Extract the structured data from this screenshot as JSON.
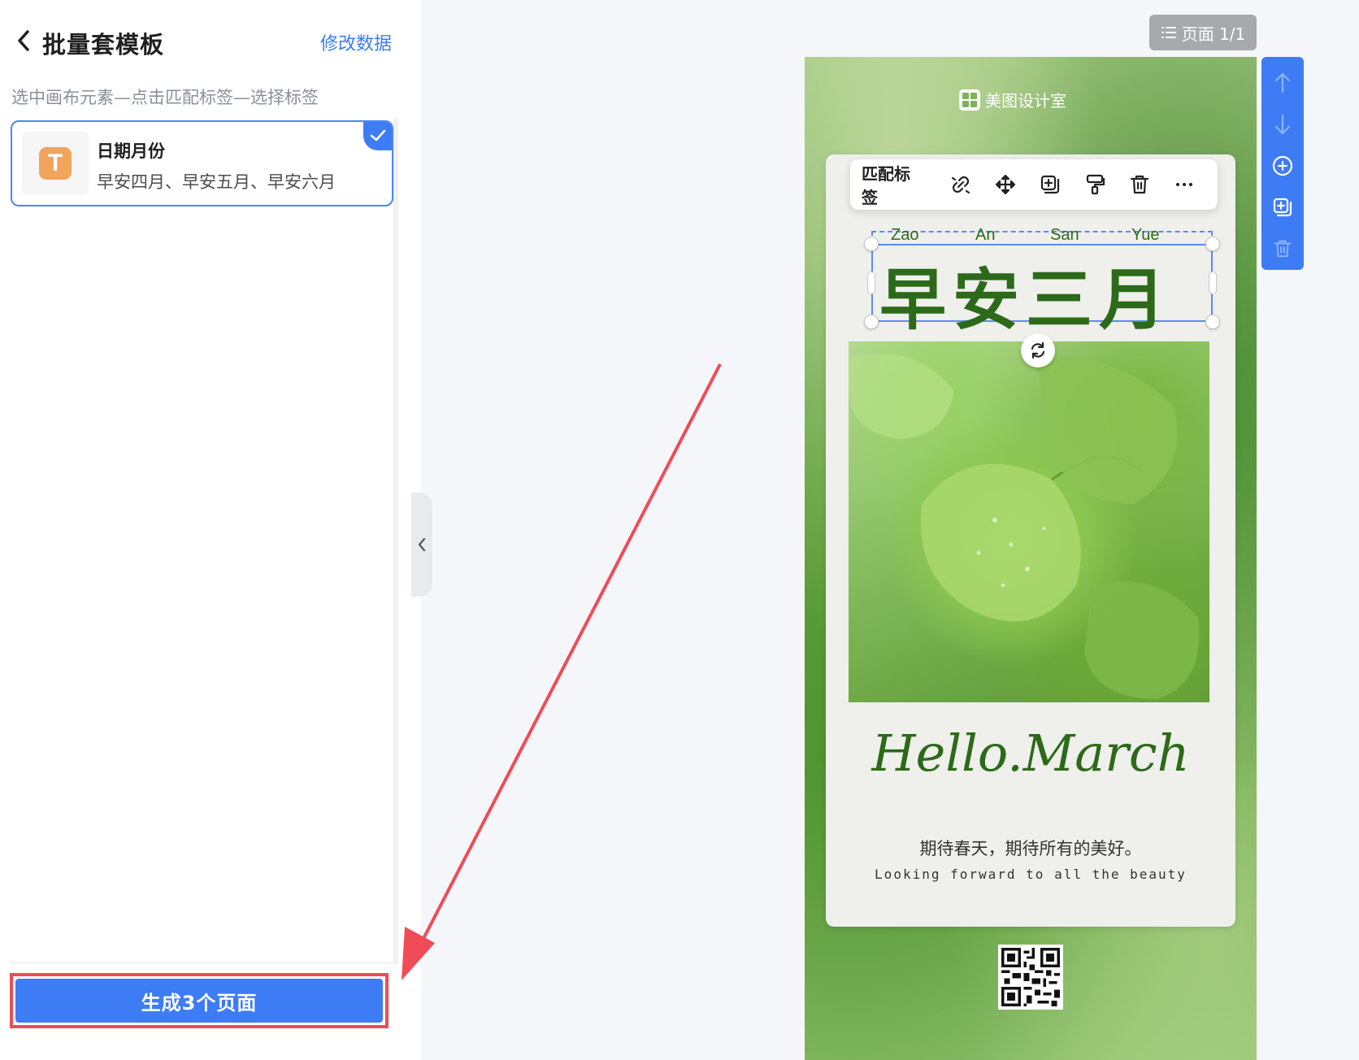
{
  "panel": {
    "title": "批量套模板",
    "edit_link": "修改数据",
    "hint": "选中画布元素—点击匹配标签—选择标签"
  },
  "tag_card": {
    "icon_letter": "T",
    "name": "日期月份",
    "values": "早安四月、早安五月、早安六月",
    "selected": true
  },
  "generate_button": "生成3个页面",
  "page_indicator": "页面 1/1",
  "toolbar": {
    "match_label": "匹配标签",
    "icons": [
      "unlink-icon",
      "move-icon",
      "copy-icon",
      "format-painter-icon",
      "delete-icon",
      "more-icon"
    ]
  },
  "poster": {
    "brand": "美图设计室",
    "pinyin": [
      "Zao",
      "An",
      "San",
      "Yue"
    ],
    "title": "早安三月",
    "hello": "Hello.March",
    "slogan_cn": "期待春天，期待所有的美好。",
    "slogan_en": "Looking forward to all the beauty"
  },
  "side_tools": [
    "arrow-up-icon",
    "arrow-down-icon",
    "add-page-icon",
    "duplicate-page-icon",
    "delete-page-icon"
  ],
  "colors": {
    "accent": "#3d7cf5",
    "highlight": "#ef4c57",
    "title_green": "#2c6a19"
  }
}
